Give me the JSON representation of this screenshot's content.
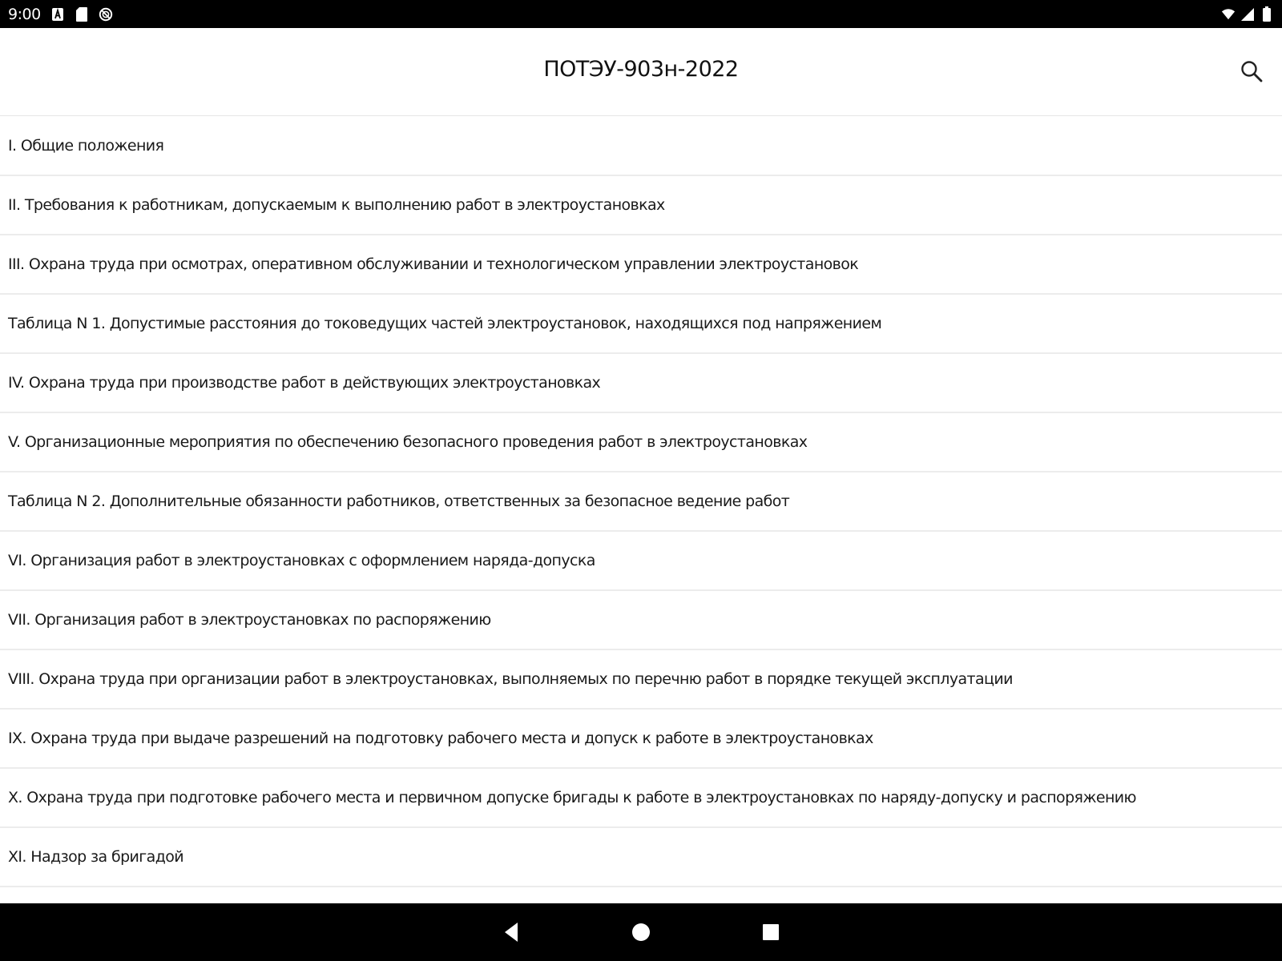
{
  "status_bar": {
    "time": "9:00",
    "left_icons": [
      "font-a-icon",
      "sd-card-icon",
      "do-not-disturb-icon"
    ],
    "right_icons": [
      "wifi-icon",
      "cell-signal-icon",
      "battery-icon"
    ]
  },
  "app_bar": {
    "title": "ПОТЭУ-903н-2022",
    "search_icon": "search-icon"
  },
  "toc": {
    "items": [
      {
        "label": "I. Общие положения"
      },
      {
        "label": "II. Требования к работникам, допускаемым к выполнению работ в электроустановках"
      },
      {
        "label": "III. Охрана труда при осмотрах, оперативном обслуживании и технологическом управлении электроустановок"
      },
      {
        "label": "Таблица N 1. Допустимые расстояния до токоведущих частей электроустановок, находящихся под напряжением"
      },
      {
        "label": "IV. Охрана труда при производстве работ в действующих электроустановках"
      },
      {
        "label": "V. Организационные мероприятия по обеспечению безопасного проведения работ в электроустановках"
      },
      {
        "label": "Таблица N 2. Дополнительные обязанности работников, ответственных за безопасное ведение работ"
      },
      {
        "label": "VI. Организация работ в электроустановках с оформлением наряда-допуска"
      },
      {
        "label": "VII. Организация работ в электроустановках по распоряжению"
      },
      {
        "label": "VIII. Охрана труда при организации работ в электроустановках, выполняемых по перечню работ в порядке текущей эксплуатации"
      },
      {
        "label": "IX. Охрана труда при выдаче разрешений на подготовку рабочего места и допуск к работе в электроустановках"
      },
      {
        "label": "X. Охрана труда при подготовке рабочего места и первичном допуске бригады к работе в электроустановках по наряду-допуску и распоряжению"
      },
      {
        "label": "XI. Надзор за бригадой"
      }
    ]
  },
  "nav_bar": {
    "icons": [
      "back-icon",
      "home-icon",
      "recents-icon"
    ]
  }
}
